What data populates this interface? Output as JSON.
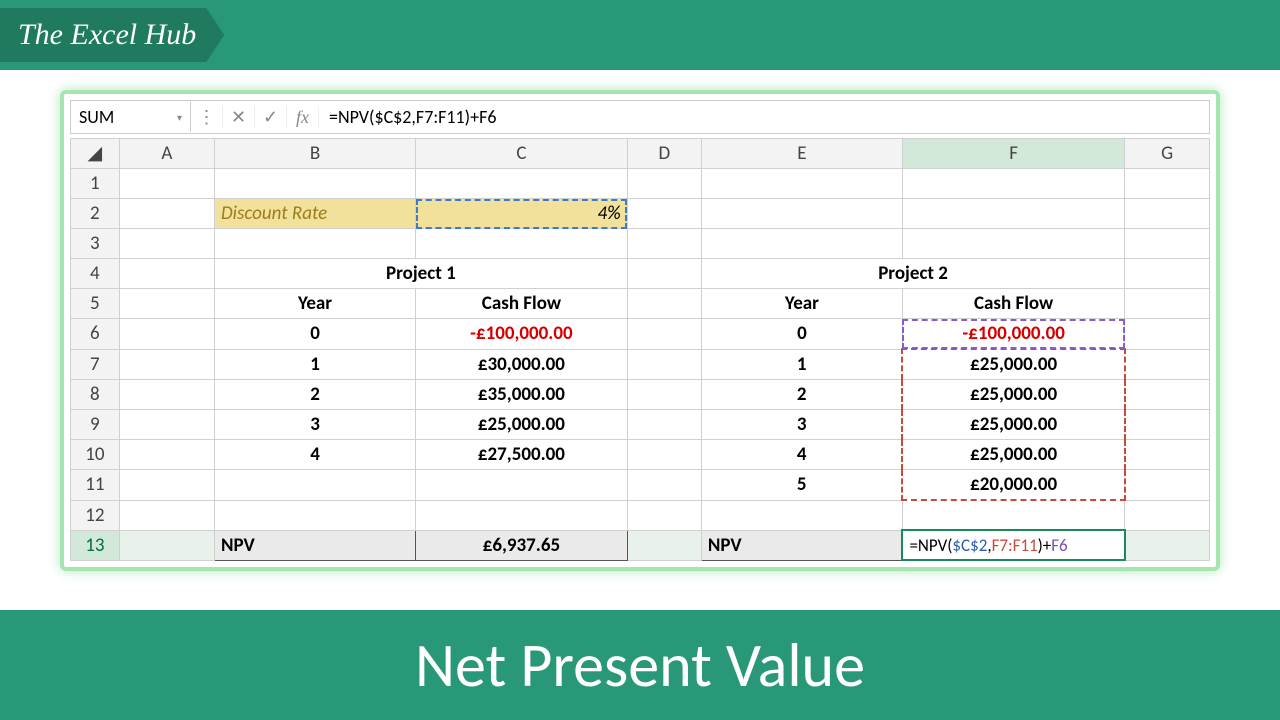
{
  "brand": {
    "name": "The Excel Hub"
  },
  "formula_bar": {
    "namebox": "SUM",
    "formula_text": "=NPV($C$2,F7:F11)+F6"
  },
  "columns": [
    "A",
    "B",
    "C",
    "D",
    "E",
    "F",
    "G"
  ],
  "rows": [
    "1",
    "2",
    "3",
    "4",
    "5",
    "6",
    "7",
    "8",
    "9",
    "10",
    "11",
    "12",
    "13"
  ],
  "discount": {
    "label": "Discount Rate",
    "value": "4%"
  },
  "project1": {
    "title": "Project 1",
    "headers": {
      "year": "Year",
      "cash": "Cash Flow"
    },
    "rows": [
      {
        "year": "0",
        "cash": "-£100,000.00",
        "neg": true
      },
      {
        "year": "1",
        "cash": "£30,000.00"
      },
      {
        "year": "2",
        "cash": "£35,000.00"
      },
      {
        "year": "3",
        "cash": "£25,000.00"
      },
      {
        "year": "4",
        "cash": "£27,500.00"
      }
    ],
    "npv_label": "NPV",
    "npv_value": "£6,937.65"
  },
  "project2": {
    "title": "Project 2",
    "headers": {
      "year": "Year",
      "cash": "Cash Flow"
    },
    "rows": [
      {
        "year": "0",
        "cash": "-£100,000.00",
        "neg": true
      },
      {
        "year": "1",
        "cash": "£25,000.00"
      },
      {
        "year": "2",
        "cash": "£25,000.00"
      },
      {
        "year": "3",
        "cash": "£25,000.00"
      },
      {
        "year": "4",
        "cash": "£25,000.00"
      },
      {
        "year": "5",
        "cash": "£20,000.00"
      }
    ],
    "npv_label": "NPV",
    "npv_formula_prefix": "=NPV(",
    "npv_formula_a": "$C$2",
    "npv_formula_sep": ",",
    "npv_formula_b": "F7:F11",
    "npv_formula_close": ")+",
    "npv_formula_c": "F6"
  },
  "footer": {
    "title": "Net Present Value"
  },
  "icons": {
    "vdots": "⋮",
    "cancel": "✕",
    "enter": "✓",
    "fx": "fx",
    "dropdown": "▾"
  }
}
